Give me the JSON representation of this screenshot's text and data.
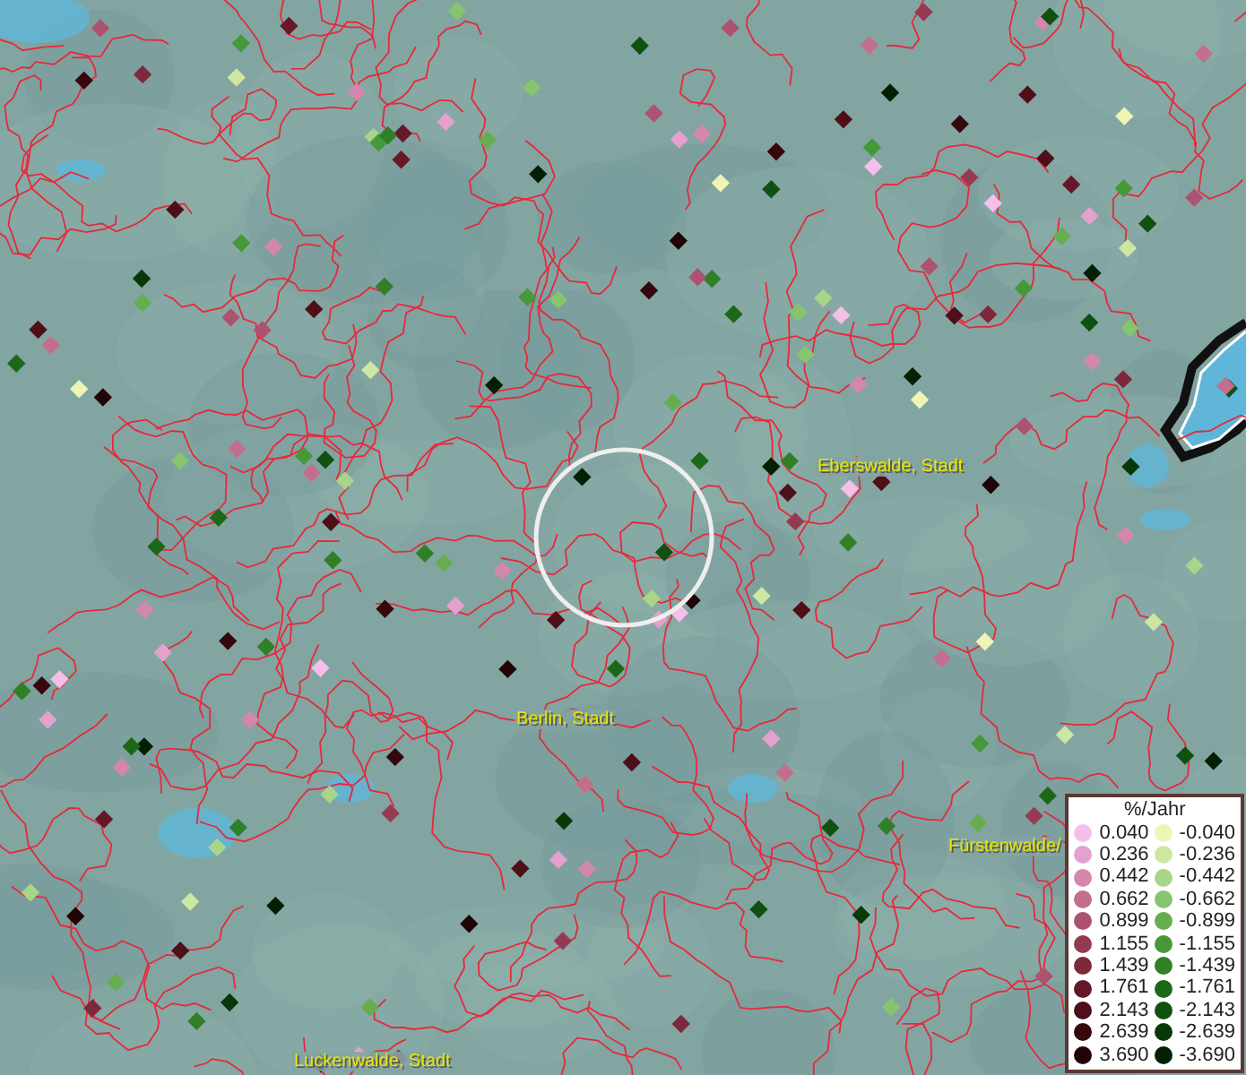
{
  "map": {
    "labels": [
      {
        "text": "Eberswalde, Stadt"
      },
      {
        "text": "Berlin, Stadt"
      },
      {
        "text": "Fürstenwalde/"
      },
      {
        "text": "Luckenwalde, Stadt"
      }
    ]
  },
  "legend": {
    "title": "%/Jahr",
    "rows": [
      {
        "positive": {
          "value": "0.040",
          "color": "#f5bfe9"
        },
        "negative": {
          "value": "-0.040",
          "color": "#eef4b4"
        }
      },
      {
        "positive": {
          "value": "0.236",
          "color": "#e4a0cf"
        },
        "negative": {
          "value": "-0.236",
          "color": "#cde6a2"
        }
      },
      {
        "positive": {
          "value": "0.442",
          "color": "#d487ad"
        },
        "negative": {
          "value": "-0.442",
          "color": "#a8d589"
        }
      },
      {
        "positive": {
          "value": "0.662",
          "color": "#c46e8e"
        },
        "negative": {
          "value": "-0.662",
          "color": "#86c46e"
        }
      },
      {
        "positive": {
          "value": "0.899",
          "color": "#ad5270"
        },
        "negative": {
          "value": "-0.899",
          "color": "#66ad50"
        }
      },
      {
        "positive": {
          "value": "1.155",
          "color": "#963a52"
        },
        "negative": {
          "value": "-1.155",
          "color": "#479838"
        }
      },
      {
        "positive": {
          "value": "1.439",
          "color": "#7e283a"
        },
        "negative": {
          "value": "-1.439",
          "color": "#2f8027"
        }
      },
      {
        "positive": {
          "value": "1.761",
          "color": "#661828"
        },
        "negative": {
          "value": "-1.761",
          "color": "#1c6818"
        }
      },
      {
        "positive": {
          "value": "2.143",
          "color": "#4e0f18"
        },
        "negative": {
          "value": "-2.143",
          "color": "#105010"
        }
      },
      {
        "positive": {
          "value": "2.639",
          "color": "#36080e"
        },
        "negative": {
          "value": "-2.639",
          "color": "#083808"
        }
      },
      {
        "positive": {
          "value": "3.690",
          "color": "#200406"
        },
        "negative": {
          "value": "-3.690",
          "color": "#042004"
        }
      }
    ]
  }
}
